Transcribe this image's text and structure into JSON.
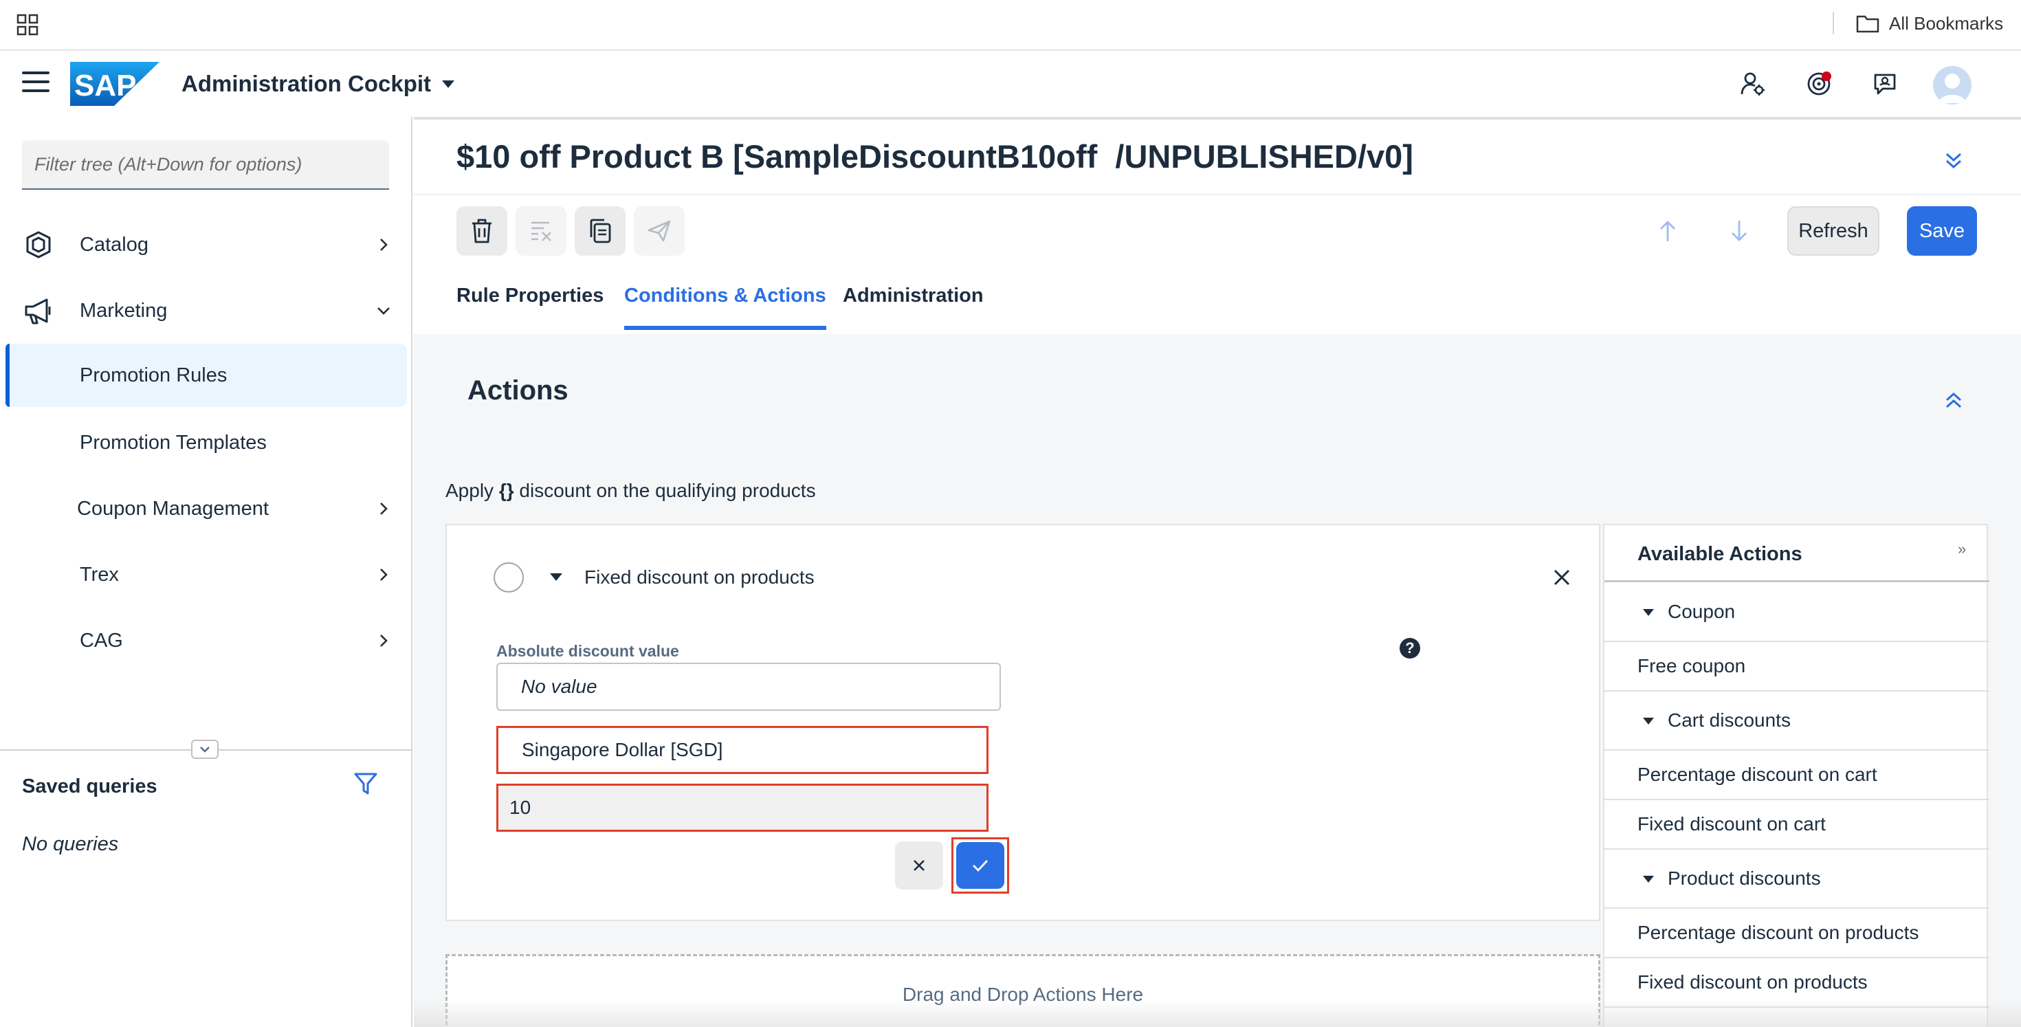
{
  "browser": {
    "bookmarks_label": "All Bookmarks"
  },
  "shell": {
    "app_title": "Administration Cockpit",
    "logo_text": "SAP",
    "notification_color": "#d0021b"
  },
  "sidebar": {
    "filter_placeholder": "Filter tree (Alt+Down for options)",
    "items": [
      {
        "label": "Catalog",
        "icon": "catalog-icon",
        "chevron": "right"
      },
      {
        "label": "Marketing",
        "icon": "megaphone-icon",
        "chevron": "down"
      },
      {
        "label": "Promotion Rules",
        "selected": true
      },
      {
        "label": "Promotion Templates"
      },
      {
        "label": "Coupon Management",
        "chevron": "right"
      },
      {
        "label": "Trex",
        "chevron": "right"
      },
      {
        "label": "CAG",
        "chevron": "right"
      }
    ],
    "saved_queries_title": "Saved queries",
    "no_queries_text": "No queries"
  },
  "editor": {
    "title": "$10 off Product B [SampleDiscountB10off  /UNPUBLISHED/v0]",
    "refresh_label": "Refresh",
    "save_label": "Save",
    "tabs": [
      {
        "label": "Rule Properties",
        "active": false
      },
      {
        "label": "Conditions & Actions",
        "active": true
      },
      {
        "label": "Administration",
        "active": false
      }
    ],
    "accent_color": "#2a6fe3"
  },
  "actions": {
    "section_title": "Actions",
    "summary_prefix": "Apply ",
    "summary_token": "{}",
    "summary_suffix": " discount on the qualifying products",
    "card": {
      "title": "Fixed discount on products",
      "field_label": "Absolute discount value",
      "help_symbol": "?",
      "no_value": "No value",
      "currency": "Singapore Dollar [SGD]",
      "amount": "10"
    },
    "drop_zone_text": "Drag and Drop Actions Here"
  },
  "available_actions": {
    "title": "Available Actions",
    "expand_symbol": "»",
    "rows": [
      {
        "label": "Coupon",
        "type": "group"
      },
      {
        "label": "Free coupon",
        "type": "leaf"
      },
      {
        "label": "Cart discounts",
        "type": "group"
      },
      {
        "label": "Percentage discount on cart",
        "type": "leaf"
      },
      {
        "label": "Fixed discount on cart",
        "type": "leaf"
      },
      {
        "label": "Product discounts",
        "type": "group"
      },
      {
        "label": "Percentage discount on products",
        "type": "leaf"
      },
      {
        "label": "Fixed discount on products",
        "type": "leaf"
      }
    ]
  }
}
